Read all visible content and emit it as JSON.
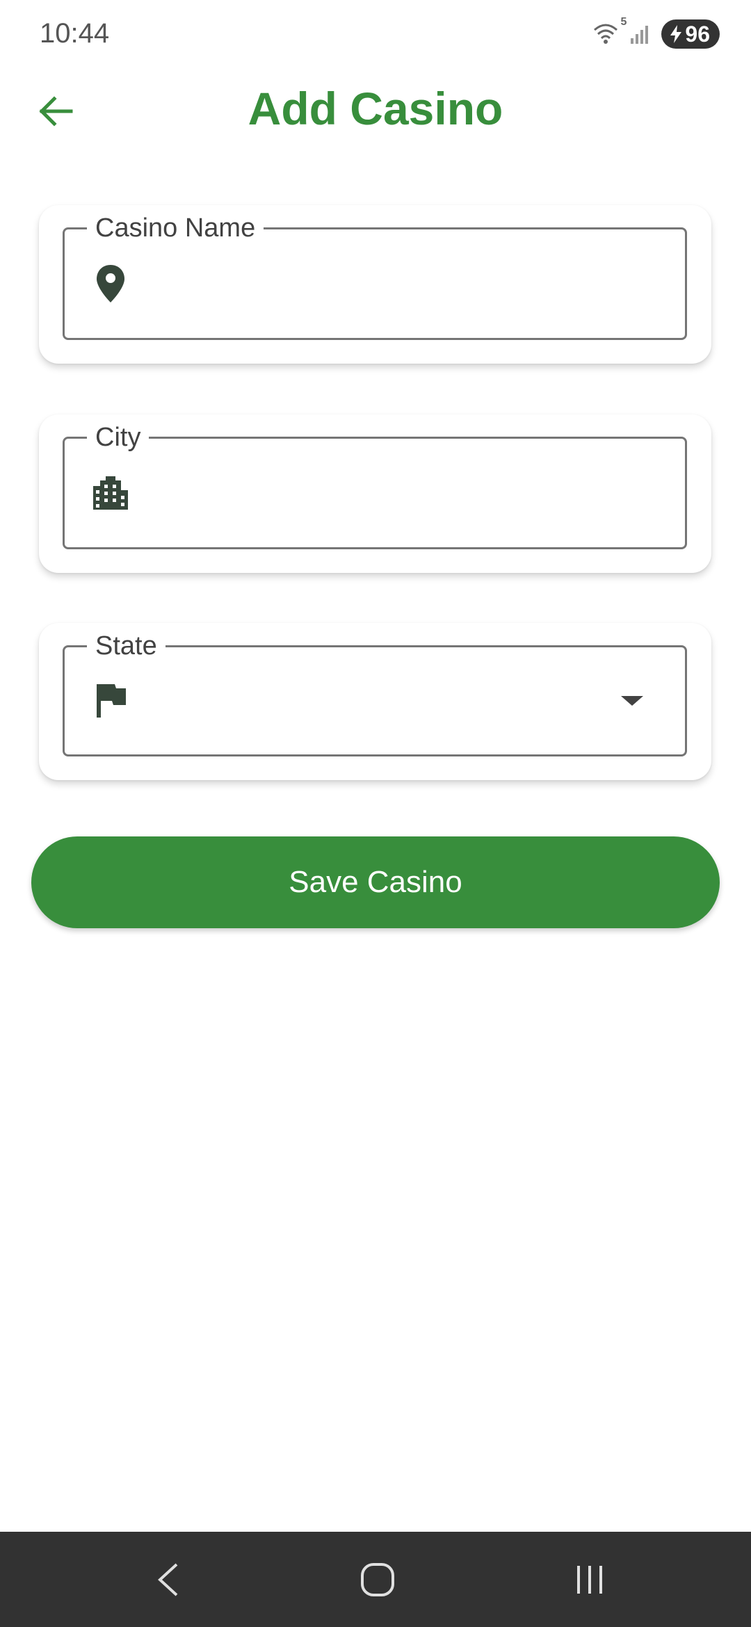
{
  "status_bar": {
    "time": "10:44",
    "wifi_badge": "5",
    "battery_level": "96"
  },
  "header": {
    "title": "Add Casino",
    "back_icon": "arrow-back-icon"
  },
  "form": {
    "casino_name": {
      "label": "Casino Name",
      "value": "",
      "icon": "location-pin-icon"
    },
    "city": {
      "label": "City",
      "value": "",
      "icon": "city-buildings-icon"
    },
    "state": {
      "label": "State",
      "selected": "",
      "icon": "flag-icon"
    }
  },
  "actions": {
    "save_label": "Save Casino"
  },
  "colors": {
    "accent": "#388e3c",
    "icon_dark": "#37473b",
    "nav_bar": "#323232"
  },
  "nav_bar": {
    "buttons": [
      "back",
      "home",
      "recents"
    ]
  }
}
